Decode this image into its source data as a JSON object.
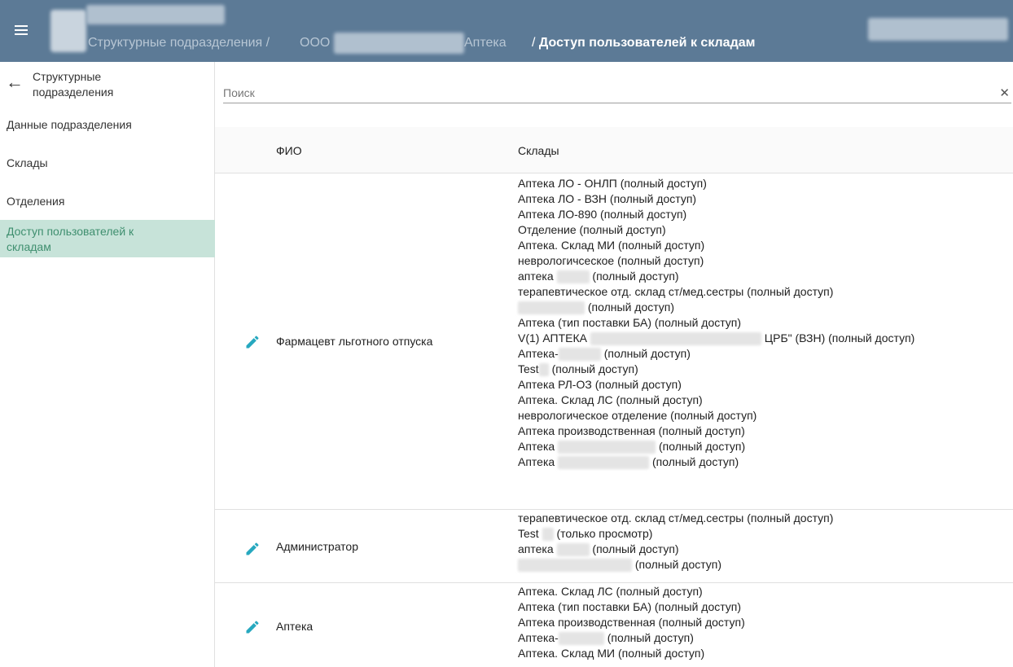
{
  "header": {
    "breadcrumb_root": "Структурные подразделения",
    "breadcrumb_sep1": "/",
    "breadcrumb_org": "ООО",
    "breadcrumb_apteka": "Аптека",
    "breadcrumb_sep2": "/",
    "breadcrumb_current": "Доступ пользователей к складам",
    "menu_icon": "hamburger-menu-icon",
    "colors": {
      "header_bg": "#5c7a96",
      "active_item_bg": "#c7e3d9",
      "active_item_text": "#3f8f6f",
      "edit_icon": "#26a8bf"
    }
  },
  "sidebar": {
    "back_icon": "arrow-left-icon",
    "back_label": "Структурные подразделения",
    "items": [
      {
        "label": "Данные подразделения",
        "active": false
      },
      {
        "label": "Склады",
        "active": false
      },
      {
        "label": "Отделения",
        "active": false
      },
      {
        "label": "Доступ пользователей к складам",
        "active": true
      }
    ]
  },
  "search": {
    "placeholder": "Поиск",
    "value": "",
    "clear_icon": "close-icon"
  },
  "table": {
    "columns": [
      "ФИО",
      "Склады"
    ],
    "rows": [
      {
        "name": "Фармацевт льготного отпуска",
        "warehouses": [
          "Аптека ЛО - ОНЛП (полный доступ)",
          "Аптека ЛО - ВЗН (полный доступ)",
          "Аптека ЛО-890 (полный доступ)",
          "Отделение (полный доступ)",
          "Аптека. Склад МИ (полный доступ)",
          "неврологичсеское (полный доступ)",
          "аптека",
          "(полный доступ)",
          "терапевтическое отд. склад ст/мед.сестры (полный доступ)",
          "(полный доступ)",
          "Аптека (тип поставки БА) (полный доступ)",
          "V(1) АПТЕКА",
          "ЦРБ\" (ВЗН) (полный доступ)",
          "Аптека-",
          "(полный доступ)",
          "Test",
          "(полный доступ)",
          "Аптека РЛ-ОЗ (полный доступ)",
          "Аптека. Склад ЛС (полный доступ)",
          "неврологическое отделение (полный доступ)",
          "Аптека производственная (полный доступ)",
          "Аптека",
          "(полный доступ)",
          "Аптека",
          "(полный доступ)"
        ]
      },
      {
        "name": "Администратор",
        "warehouses": [
          "терапевтическое отд. склад ст/мед.сестры (полный доступ)",
          "Test",
          "(только просмотр)",
          "аптека",
          "(полный доступ)",
          "(полный доступ)"
        ]
      },
      {
        "name": "Аптека",
        "warehouses": [
          "Аптека. Склад ЛС (полный доступ)",
          "Аптека (тип поставки БА) (полный доступ)",
          "Аптека производственная (полный доступ)",
          "Аптека-",
          "(полный доступ)",
          "Аптека. Склад МИ (полный доступ)"
        ]
      }
    ]
  },
  "icons": {
    "edit": "pencil-edit-icon"
  }
}
